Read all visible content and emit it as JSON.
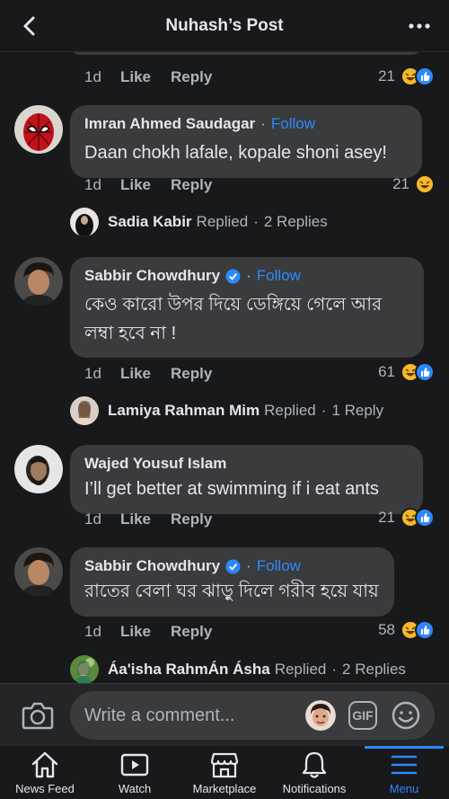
{
  "header": {
    "title": "Nuhash’s Post"
  },
  "top_partial": {
    "time": "1d",
    "like": "Like",
    "reply": "Reply",
    "count": "21"
  },
  "comments": [
    {
      "author": "Imran Ahmed Saudagar",
      "follow": "Follow",
      "verified": false,
      "text": "Daan chokh lafale, kopale shoni asey!",
      "time": "1d",
      "like": "Like",
      "reply": "Reply",
      "count": "21",
      "reactions": [
        "haha"
      ],
      "replies": {
        "name": "Sadia Kabir",
        "verb": "Replied",
        "summary": "2 Replies"
      }
    },
    {
      "author": "Sabbir Chowdhury",
      "follow": "Follow",
      "verified": true,
      "text": "কেও কারো উপর দিয়ে ডেঙ্গিয়ে গেলে আর লম্বা হবে না !",
      "time": "1d",
      "like": "Like",
      "reply": "Reply",
      "count": "61",
      "reactions": [
        "haha",
        "like"
      ],
      "replies": {
        "name": "Lamiya Rahman Mim",
        "verb": "Replied",
        "summary": "1 Reply"
      }
    },
    {
      "author": "Wajed Yousuf Islam",
      "follow": "",
      "verified": false,
      "text": "I’ll get better at swimming if i eat ants",
      "time": "1d",
      "like": "Like",
      "reply": "Reply",
      "count": "21",
      "reactions": [
        "haha",
        "like"
      ]
    },
    {
      "author": "Sabbir Chowdhury",
      "follow": "Follow",
      "verified": true,
      "text": "রাতের বেলা ঘর ঝাড়ু দিলে গরীব হয়ে যায়",
      "time": "1d",
      "like": "Like",
      "reply": "Reply",
      "count": "58",
      "reactions": [
        "haha",
        "like"
      ],
      "replies": {
        "name": "Áa'isha RahmÁn Ásha",
        "verb": "Replied",
        "summary": "2 Replies"
      }
    }
  ],
  "composer": {
    "placeholder": "Write a comment...",
    "gif_label": "GIF"
  },
  "tabs": [
    {
      "label": "News Feed",
      "icon": "home-icon"
    },
    {
      "label": "Watch",
      "icon": "watch-icon"
    },
    {
      "label": "Marketplace",
      "icon": "marketplace-icon"
    },
    {
      "label": "Notifications",
      "icon": "bell-icon"
    },
    {
      "label": "Menu",
      "icon": "menu-icon",
      "active": true
    }
  ],
  "colors": {
    "background": "#18191a",
    "bubble": "#3a3b3c",
    "accent": "#2d88ff",
    "muted": "#b0b3b8",
    "haha": "#f7b928",
    "like": "#2d88ff"
  }
}
